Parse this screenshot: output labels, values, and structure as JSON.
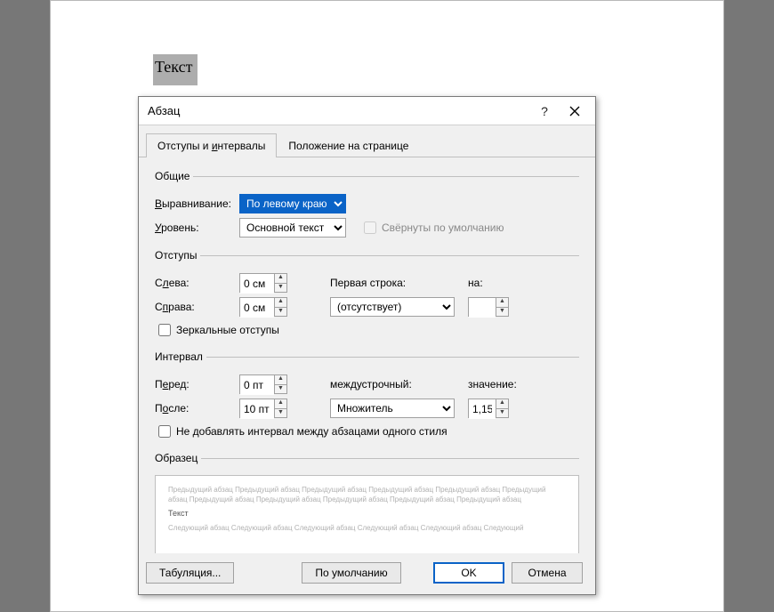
{
  "document": {
    "selected_text": "Текст"
  },
  "dialog": {
    "title": "Абзац",
    "tabs": {
      "indent": "Отступы и интервалы",
      "position": "Положение на странице"
    },
    "general": {
      "legend": "Общие",
      "alignment_label": "Выравнивание:",
      "alignment_value": "По левому краю",
      "level_label": "Уровень:",
      "level_value": "Основной текст",
      "collapsed_label": "Свёрнуты по умолчанию"
    },
    "indentation": {
      "legend": "Отступы",
      "left_label": "Слева:",
      "left_value": "0 см",
      "right_label": "Справа:",
      "right_value": "0 см",
      "first_line_label": "Первая строка:",
      "special_value": "(отсутствует)",
      "by_label": "на:",
      "by_value": "",
      "mirror_label": "Зеркальные отступы"
    },
    "spacing": {
      "legend": "Интервал",
      "before_label": "Перед:",
      "before_value": "0 пт",
      "after_label": "После:",
      "after_value": "10 пт",
      "line_label": "междустрочный:",
      "line_value": "Множитель",
      "at_label": "значение:",
      "at_value": "1,15",
      "no_space_label": "Не добавлять интервал между абзацами одного стиля"
    },
    "preview": {
      "legend": "Образец",
      "prev_line": "Предыдущий абзац Предыдущий абзац Предыдущий абзац Предыдущий абзац Предыдущий абзац Предыдущий абзац Предыдущий абзац Предыдущий абзац Предыдущий абзац Предыдущий абзац Предыдущий абзац",
      "sample": "Текст",
      "next_line": "Следующий абзац Следующий абзац Следующий абзац Следующий абзац Следующий абзац Следующий"
    },
    "buttons": {
      "tabs": "Табуляция...",
      "default": "По умолчанию",
      "ok": "OK",
      "cancel": "Отмена"
    }
  }
}
